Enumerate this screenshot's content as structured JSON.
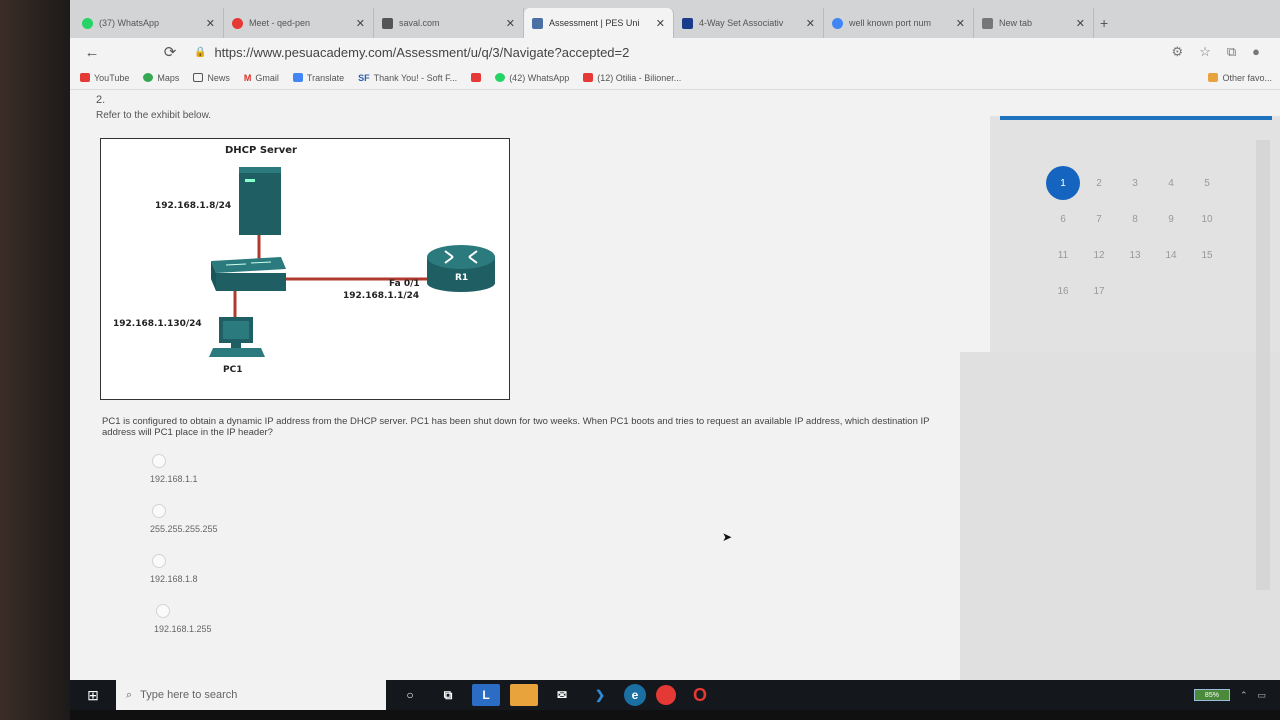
{
  "browser": {
    "tabs": [
      {
        "label": "(37) WhatsApp",
        "color": "#25d366"
      },
      {
        "label": "Meet - qed-pen",
        "color": "#e53935"
      },
      {
        "label": "saval.com",
        "color": "#555555"
      },
      {
        "label": "Assessment | PES Uni",
        "color": "#4a6fa5",
        "active": true
      },
      {
        "label": "4-Way Set Associativ",
        "color": "#1a3a8a"
      },
      {
        "label": "well known port num",
        "color": "#4285f4"
      },
      {
        "label": "New tab",
        "color": "#777777"
      }
    ],
    "url": "https://www.pesuacademy.com/Assessment/u/q/3/Navigate?accepted=2",
    "bookmarks": [
      "YouTube",
      "Maps",
      "News",
      "Gmail",
      "Translate",
      "Thank You! - Soft F...",
      "(42) WhatsApp",
      "(12) Otilia - Bilioner..."
    ],
    "other_bookmarks": "Other favo..."
  },
  "question": {
    "number": "2.",
    "refer_text": "Refer to the exhibit below.",
    "text": "PC1 is configured to obtain a dynamic IP address from the DHCP server. PC1 has been shut down for two weeks. When PC1 boots and tries to request an available IP address, which destination IP address will PC1 place in the IP header?",
    "options": [
      "192.168.1.1",
      "255.255.255.255",
      "192.168.1.8",
      "192.168.1.255"
    ]
  },
  "exhibit": {
    "dhcp_label": "DHCP Server",
    "dhcp_ip": "192.168.1.8/24",
    "router_name": "R1",
    "router_int": "Fa 0/1",
    "router_ip": "192.168.1.1/24",
    "pc_ip": "192.168.1.130/24",
    "pc_label": "PC1"
  },
  "navigator": {
    "current": 1,
    "numbers": [
      "1",
      "2",
      "3",
      "4",
      "5",
      "6",
      "7",
      "8",
      "9",
      "10",
      "11",
      "12",
      "13",
      "14",
      "15",
      "16",
      "17"
    ]
  },
  "taskbar": {
    "search_placeholder": "Type here to search",
    "battery": "85%"
  },
  "colors": {
    "accent": "#1565c0",
    "device": "#1f5f63",
    "link": "#b03a2e"
  }
}
